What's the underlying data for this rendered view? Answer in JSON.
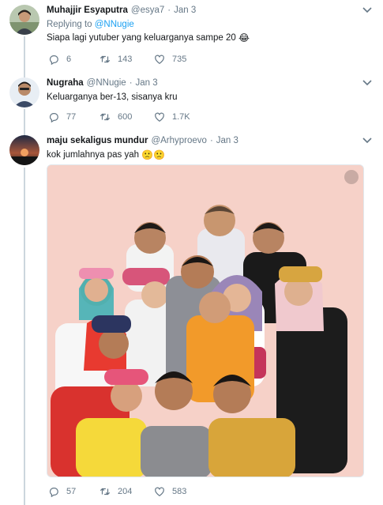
{
  "tweets": [
    {
      "name": "Muhajjir Esyaputra",
      "handle": "@esya7",
      "date": "Jan 3",
      "reply_prefix": "Replying to",
      "reply_mention": "@NNugie",
      "text": "Siapa lagi yutuber yang keluarganya sampe 20",
      "emoji": "😂",
      "replies": "6",
      "retweets": "143",
      "likes": "735"
    },
    {
      "name": "Nugraha",
      "handle": "@NNugie",
      "date": "Jan 3",
      "text": "Keluarganya ber-13, sisanya kru",
      "replies": "77",
      "retweets": "600",
      "likes": "1.7K"
    },
    {
      "name": "maju sekaligus mundur",
      "handle": "@Arhyproevo",
      "date": "Jan 3",
      "text": "kok jumlahnya pas yah",
      "emoji": "🙁🙁",
      "replies": "57",
      "retweets": "204",
      "likes": "583"
    }
  ],
  "dot": "·",
  "colors": {
    "accent": "#1da1f2",
    "muted": "#657786",
    "text": "#14171a",
    "photo_background": "#f6d1c8"
  },
  "icons": [
    "chevron-down-icon",
    "reply-icon",
    "retweet-icon",
    "like-icon",
    "close-icon"
  ]
}
